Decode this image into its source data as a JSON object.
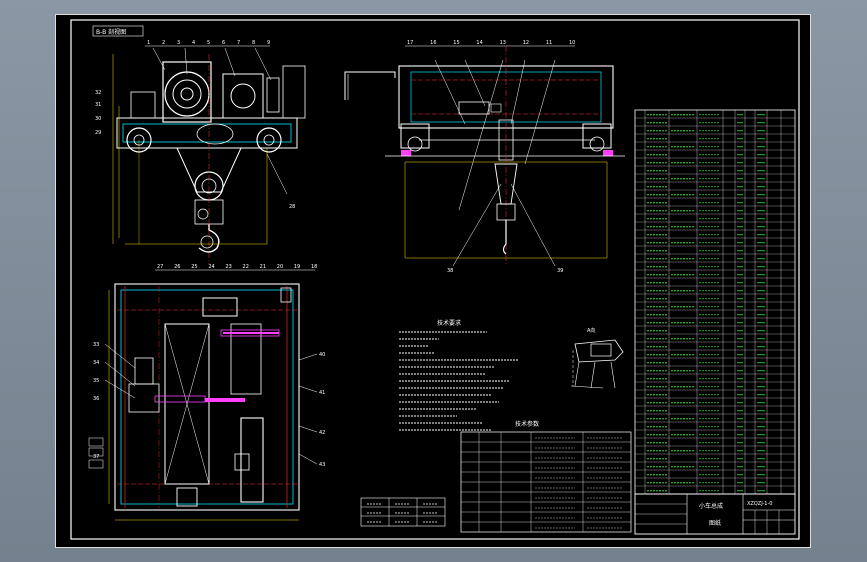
{
  "drawing": {
    "view_title": "B-B 剖视图",
    "tech_req_title": "技术要求",
    "spec_table_title": "技术参数",
    "title_block_name": "小车总成",
    "title_block_label": "图纸",
    "title_block_code": "XZQZJ-1-0",
    "detail_callout": "A向",
    "part_numbers_top_left": [
      "1",
      "2",
      "3",
      "4",
      "5",
      "6",
      "7",
      "8",
      "9"
    ],
    "part_numbers_top_right": [
      "17",
      "16",
      "15",
      "14",
      "13",
      "12",
      "11",
      "10"
    ],
    "part_numbers_plan": [
      "27",
      "26",
      "25",
      "24",
      "23",
      "22",
      "21",
      "20",
      "19",
      "18"
    ]
  },
  "colors": {
    "background": "#000000",
    "border": "#ffffff",
    "frame_cyan": "#00e5ff",
    "dimension_yellow": "#ffe000",
    "centerline_red": "#ff3030",
    "part_magenta": "#ff40ff",
    "table_green": "#40ff40"
  }
}
